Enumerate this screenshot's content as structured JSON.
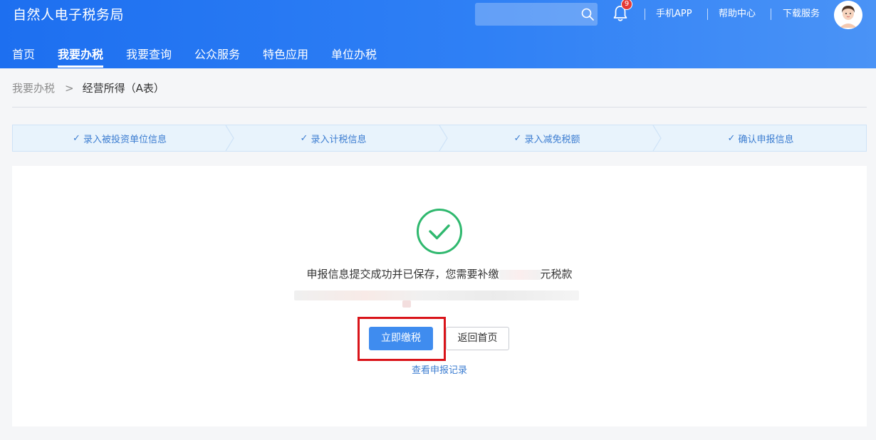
{
  "header": {
    "title": "自然人电子税务局",
    "search": {
      "placeholder": ""
    },
    "notification_count": "9",
    "links": {
      "mobile_app": "手机APP",
      "help": "帮助中心",
      "download": "下载服务"
    }
  },
  "nav": {
    "items": [
      "首页",
      "我要办税",
      "我要查询",
      "公众服务",
      "特色应用",
      "单位办税"
    ],
    "active": "我要办税"
  },
  "breadcrumb": {
    "root": "我要办税",
    "current": "经营所得（A表）"
  },
  "steps": [
    "录入被投资单位信息",
    "录入计税信息",
    "录入减免税额",
    "确认申报信息"
  ],
  "result": {
    "message": "申报信息提交成功并已保存，您需要补缴",
    "message_tail": "元税款",
    "pay_button": "立即缴税",
    "home_button": "返回首页",
    "record_link": "查看申报记录"
  },
  "colors": {
    "header_blue": "#1d6ff0",
    "success_green": "#2fb86e",
    "primary_button": "#3f8cef",
    "highlight_red": "#d9141a",
    "link_blue": "#3c7dd1"
  }
}
